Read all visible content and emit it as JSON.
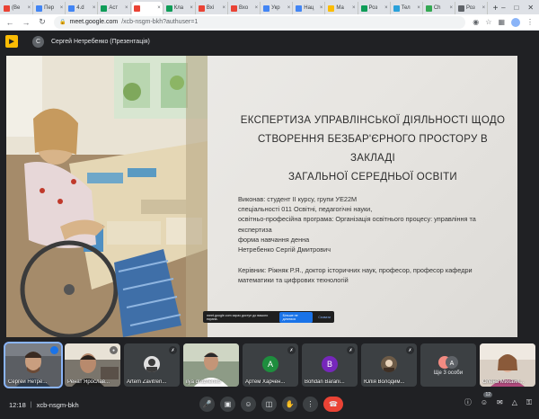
{
  "browser": {
    "tabs": [
      {
        "label": "(Be",
        "color": "#ea4335"
      },
      {
        "label": "Пер",
        "color": "#4285f4"
      },
      {
        "label": "4.d",
        "color": "#4285f4"
      },
      {
        "label": "Аст",
        "color": "#0f9d58"
      },
      {
        "label": "",
        "color": "#ea4335",
        "active": true
      },
      {
        "label": "Кла",
        "color": "#0f9d58"
      },
      {
        "label": "Вхі",
        "color": "#ea4335"
      },
      {
        "label": "Вхо",
        "color": "#ea4335"
      },
      {
        "label": "Укр",
        "color": "#4285f4"
      },
      {
        "label": "Нац",
        "color": "#4285f4"
      },
      {
        "label": "Ма",
        "color": "#fbbc04"
      },
      {
        "label": "Роз",
        "color": "#0f9d58"
      },
      {
        "label": "Тел",
        "color": "#2aa1da"
      },
      {
        "label": "Ch",
        "color": "#34a853"
      },
      {
        "label": "Роз",
        "color": "#5f6368"
      }
    ],
    "url_host": "meet.google.com",
    "url_path": "/xcb-nsgm-bkh?authuser=1"
  },
  "meet": {
    "presenter_initial": "C",
    "presenter_label": "Сергей Нетребенко (Презентація)"
  },
  "slide": {
    "title_lines": [
      "ЕКСПЕРТИЗА УПРАВЛІНСЬКОЇ ДІЯЛЬНОСТІ ЩОДО",
      "СТВОРЕННЯ БЕЗБАР'ЄРНОГО ПРОСТОРУ В ЗАКЛАДІ",
      "ЗАГАЛЬНОЇ СЕРЕДНЬОЇ ОСВІТИ"
    ],
    "body_lines": [
      "Виконав: студент ІІ курсу, групи УЕ22М",
      "спеціальності 011 Освітні, педагогічні науки,",
      "освітньо-професійна програма: Організація освітнього процесу: управління та",
      "експертиза",
      "форма навчання денна",
      "Нетребенко Сергій Дмитрович"
    ],
    "supervisor_lines": [
      "Керівник: Ріжняк Р.Я., доктор історичних наук, професор, професор кафедри",
      "математики та цифрових технологій"
    ]
  },
  "notification": {
    "text": "meet.google.com зараз доступ до вашого екрана.",
    "primary": "Більше не ділитися",
    "secondary": "Сховати"
  },
  "participants": [
    {
      "name": "Сергей Нетре...",
      "type": "video",
      "speaking": true
    },
    {
      "name": "Ренат Ярослав...",
      "type": "video"
    },
    {
      "name": "Artem Zavitren...",
      "type": "avatar",
      "muted": true
    },
    {
      "name": "ilya drozhenko",
      "type": "video"
    },
    {
      "name": "Артем Харчен...",
      "type": "initial",
      "initial": "A",
      "color": "#1e8e3e",
      "muted": true
    },
    {
      "name": "Bohdan Barani...",
      "type": "initial",
      "initial": "B",
      "color": "#7627bb",
      "muted": true
    },
    {
      "name": "Юлія Володим...",
      "type": "avatar",
      "muted": true
    },
    {
      "name": "Ще 3 особи",
      "type": "more"
    },
    {
      "name": "Олена Михайл...",
      "type": "video"
    }
  ],
  "bottom": {
    "time": "12:18",
    "separator": "|",
    "meeting_code": "xcb-nsgm-bkh",
    "people_count": "12"
  }
}
